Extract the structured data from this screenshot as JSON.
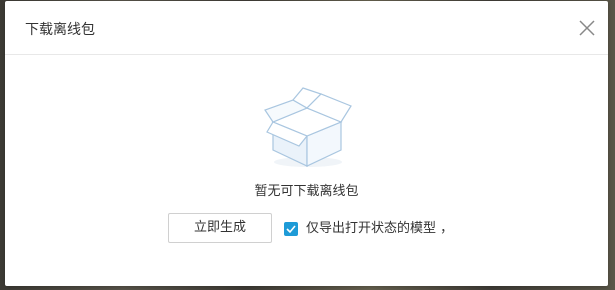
{
  "dialog": {
    "title": "下载离线包",
    "close_icon": "close-icon"
  },
  "empty_state": {
    "illustration_icon": "empty-box-icon",
    "message": "暂无可下载离线包"
  },
  "actions": {
    "generate_label": "立即生成",
    "only_open_models": {
      "checked": true,
      "label": "仅导出打开状态的模型 ，"
    }
  },
  "colors": {
    "accent": "#1e9bd7",
    "text": "#333333",
    "border": "#d0d0d0",
    "box_stroke": "#a9c6e0",
    "box_fill": "#eaf2fa"
  }
}
